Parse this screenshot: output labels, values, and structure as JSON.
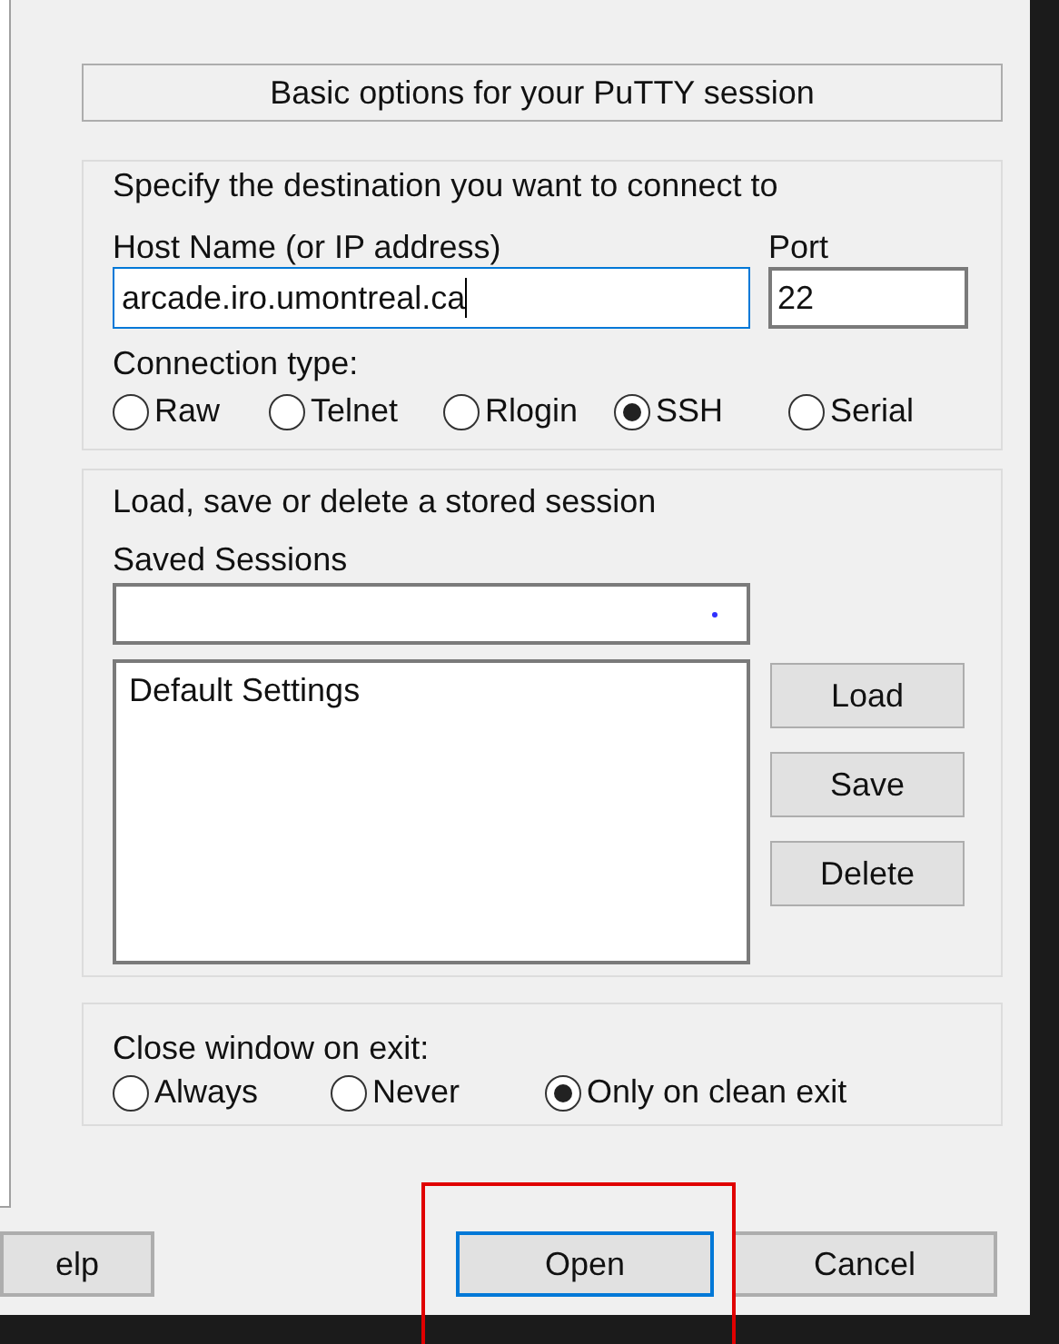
{
  "header": "Basic options for your PuTTY session",
  "destination": {
    "legend": "Specify the destination you want to connect to",
    "host": {
      "label": "Host Name (or IP address)",
      "value": "arcade.iro.umontreal.ca",
      "focused": true
    },
    "port": {
      "label": "Port",
      "value": "22",
      "focused": false
    },
    "connection_type": {
      "label": "Connection type:",
      "options": [
        {
          "label": "Raw",
          "selected": false
        },
        {
          "label": "Telnet",
          "selected": false
        },
        {
          "label": "Rlogin",
          "selected": false
        },
        {
          "label": "SSH",
          "selected": true
        },
        {
          "label": "Serial",
          "selected": false
        }
      ]
    }
  },
  "sessions": {
    "legend": "Load, save or delete a stored session",
    "label": "Saved Sessions",
    "items": [
      {
        "label": "Default Settings"
      }
    ],
    "buttons": [
      {
        "label": "Load"
      },
      {
        "label": "Save"
      },
      {
        "label": "Delete"
      }
    ]
  },
  "close_on_exit": {
    "label": "Close window on exit:",
    "options": [
      {
        "label": "Always",
        "selected": false
      },
      {
        "label": "Never",
        "selected": false
      },
      {
        "label": "Only on clean exit",
        "selected": true
      }
    ]
  },
  "buttons": [
    {
      "label": "elp",
      "default": false
    },
    {
      "label": "Open",
      "default": true
    },
    {
      "label": "Cancel",
      "default": false
    }
  ]
}
